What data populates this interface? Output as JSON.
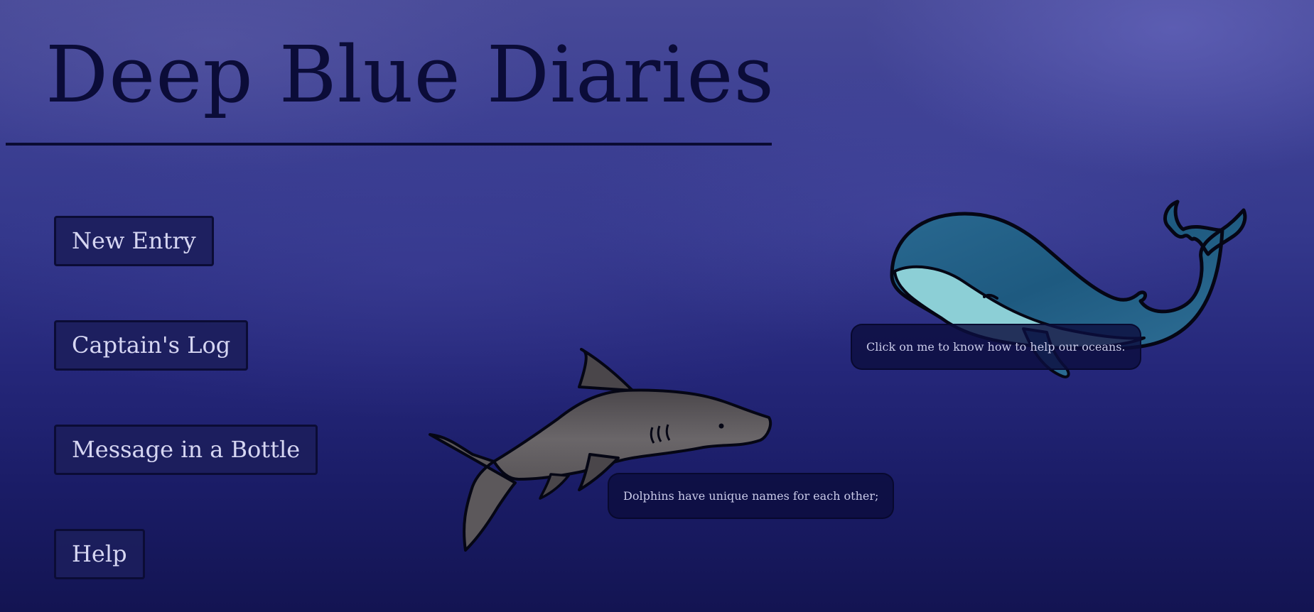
{
  "header": {
    "title": "Deep Blue Diaries"
  },
  "nav": {
    "new_entry": "New Entry",
    "captains_log": "Captain's Log",
    "message_in_bottle": "Message in a Bottle",
    "help": "Help"
  },
  "tooltips": {
    "whale": "Click on me to know how to help our oceans.",
    "shark": "Dolphins have unique names for each other;"
  },
  "icons": {
    "whale": "whale-icon",
    "shark": "shark-icon"
  },
  "colors": {
    "background_top": "#484a98",
    "background_bottom": "#131452",
    "title_text": "#0b0c38",
    "button_bg": "#1c1e5c",
    "button_text": "#d6d6f2",
    "whale_body": "#1e5a80",
    "whale_belly": "#8ccfd6",
    "shark_body": "#5f5b5e"
  }
}
